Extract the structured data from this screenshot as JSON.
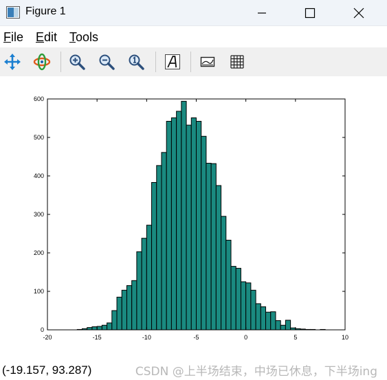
{
  "window": {
    "title": "Figure 1"
  },
  "menu": {
    "file": "File",
    "edit": "Edit",
    "tools": "Tools"
  },
  "toolbar": {
    "icons": [
      "pan-icon",
      "rotate-icon",
      "zoom-in-icon",
      "zoom-out-icon",
      "autoscale-icon",
      "insert-text-icon",
      "toggle-axes-icon",
      "toggle-grid-icon"
    ]
  },
  "status": {
    "coordinates": "(-19.157, 93.287)",
    "watermark": "CSDN @上半场结束，中场已休息，下半场ing"
  },
  "colors": {
    "bar_fill": "#1a8a80",
    "bar_edge": "#000000",
    "titlebar": "#f0f4f9",
    "toolbar": "#f0f0f0"
  },
  "chart_data": {
    "type": "bar",
    "histogram": true,
    "bin_width": 0.5,
    "x_start": -17,
    "values": [
      1,
      3,
      6,
      8,
      9,
      12,
      18,
      50,
      85,
      103,
      115,
      128,
      203,
      238,
      272,
      383,
      427,
      461,
      542,
      551,
      568,
      594,
      532,
      551,
      542,
      503,
      433,
      432,
      375,
      295,
      233,
      165,
      160,
      125,
      122,
      103,
      68,
      60,
      46,
      47,
      24,
      12,
      25,
      5,
      3,
      2,
      1,
      1,
      0,
      1
    ],
    "xlim": [
      -20,
      10
    ],
    "ylim": [
      0,
      600
    ],
    "xticks": [
      "-20",
      "-15",
      "-10",
      "-5",
      "0",
      "5",
      "10"
    ],
    "yticks": [
      "0",
      "100",
      "200",
      "300",
      "400",
      "500",
      "600"
    ],
    "xlabel": "",
    "ylabel": "",
    "title": "",
    "grid": false
  }
}
